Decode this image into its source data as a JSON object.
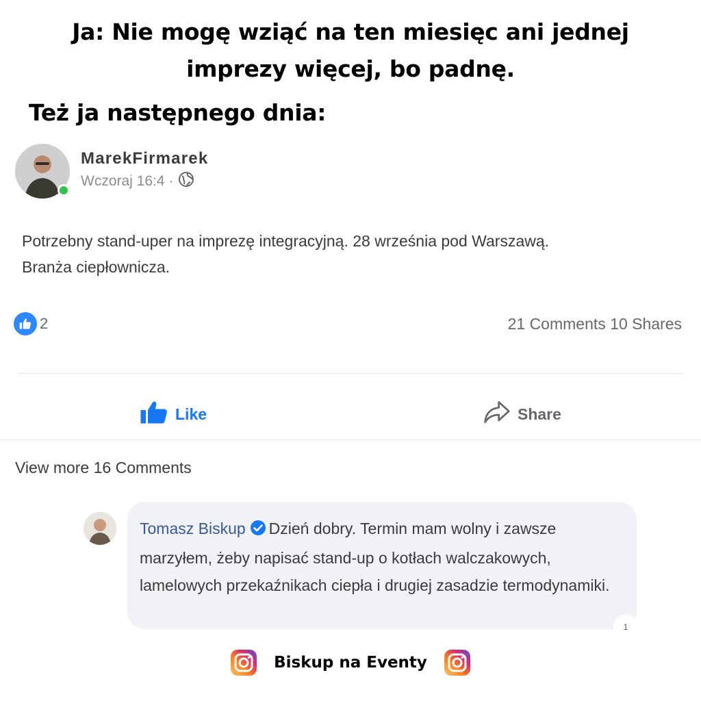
{
  "meme": {
    "line1": "Ja: Nie mogę wziąć na ten miesięc ani jednej",
    "line2": "imprezy więcej, bo padnę.",
    "line3": "Też ja następnego dnia:"
  },
  "post": {
    "author": "MarekFirmarek",
    "time": "Wczoraj 16:4",
    "separator": "·",
    "privacy_icon": "globe-icon",
    "body_line1": "Potrzebny stand-uper na imprezę integracyjną. 28 września pod Warszawą.",
    "body_line2": "Branża ciepłownicza.",
    "reaction_count": "2",
    "stats": "21 Comments 10 Shares",
    "like_label": "Like",
    "share_label": "Share"
  },
  "comments": {
    "view_more": "View more 16 Comments",
    "items": [
      {
        "author": "Tomasz Biskup",
        "text": "Dzień dobry. Termin mam wolny i zawsze marzyłem, żeby napisać stand-up o kotłach walczakowych, lamelowych przekaźnikach ciepła i drugiej zasadzie termodynamiki.",
        "reply_count": "1"
      }
    ]
  },
  "footer": {
    "label": "Biskup na Eventy",
    "icon": "instagram-icon"
  },
  "colors": {
    "facebook_blue": "#1877f2",
    "link_blue": "#385898",
    "online_green": "#31c24d",
    "bubble_bg": "#f0f2f5"
  }
}
